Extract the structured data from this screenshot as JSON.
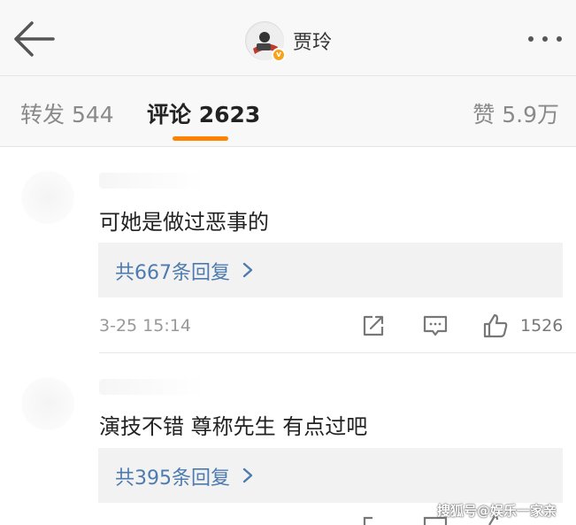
{
  "header": {
    "username": "贾玲",
    "verified_badge": "v",
    "back_icon": "arrow-left-icon",
    "more_icon": "more-dots-icon"
  },
  "tabs": {
    "reposts": "转发 544",
    "comments": "评论 2623",
    "likes": "赞 5.9万",
    "active": "comments",
    "accent_color": "#ff8200"
  },
  "comments": [
    {
      "text": "可她是做过恶事的",
      "reply_label": "共667条回复",
      "timestamp": "3-25 15:14",
      "like_count": "1526"
    },
    {
      "text": "演技不错 尊称先生 有点过吧",
      "reply_label": "共395条回复"
    }
  ],
  "colors": {
    "reply_link": "#4d7bb0",
    "reply_box_bg": "#f2f2f2",
    "verified_badge": "#f7a21a"
  },
  "watermark": "搜狐号@娱乐一家亲"
}
